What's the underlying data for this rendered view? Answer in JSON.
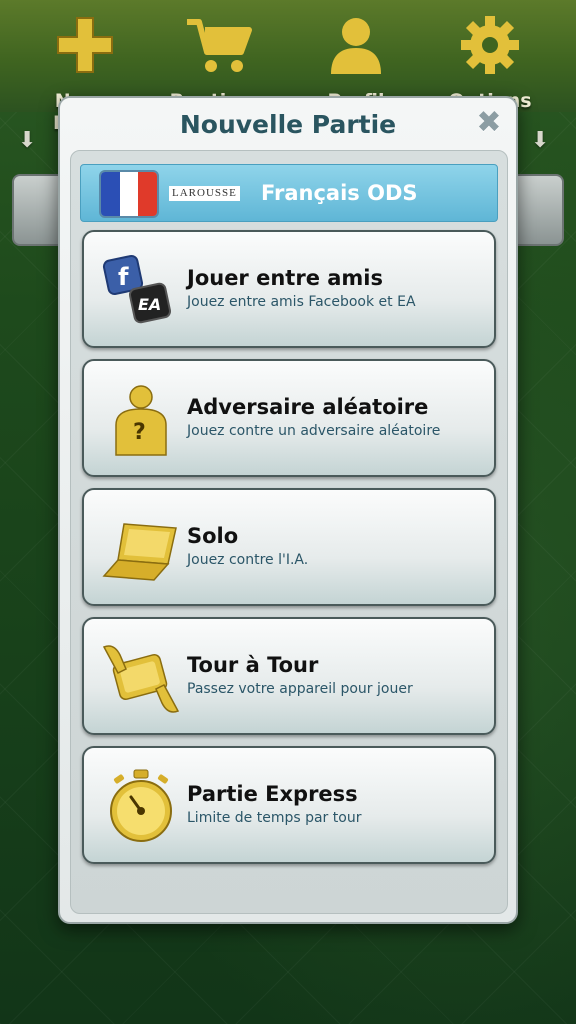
{
  "toolbar": {
    "items": [
      {
        "label": "Nouv. Partie",
        "icon": "plus-icon"
      },
      {
        "label": "Boutique",
        "icon": "cart-icon"
      },
      {
        "label": "Profil",
        "icon": "profile-icon"
      },
      {
        "label": "Options",
        "icon": "gear-icon"
      }
    ]
  },
  "modal": {
    "title": "Nouvelle Partie",
    "close_icon": "close-icon",
    "language": {
      "brand": "LAROUSSE",
      "name": "Français ODS",
      "flag_colors": [
        "#2b4fb5",
        "#ffffff",
        "#e03a2a"
      ]
    },
    "options": [
      {
        "title": "Jouer entre amis",
        "subtitle": "Jouez entre amis Facebook et EA",
        "icon": "facebook-ea-icon",
        "badge_f": "f",
        "badge_ea": "EA"
      },
      {
        "title": "Adversaire aléatoire",
        "subtitle": "Jouez contre un adversaire aléatoire",
        "icon": "random-opponent-icon",
        "badge_q": "?"
      },
      {
        "title": "Solo",
        "subtitle": "Jouez contre l'I.A.",
        "icon": "laptop-icon"
      },
      {
        "title": "Tour à Tour",
        "subtitle": "Passez votre appareil pour jouer",
        "icon": "pass-device-icon"
      },
      {
        "title": "Partie Express",
        "subtitle": "Limite de temps par tour",
        "icon": "stopwatch-icon"
      }
    ]
  },
  "colors": {
    "gold": "#e2c03a",
    "title_teal": "#2a5560",
    "lang_blue": "#6cc1df"
  }
}
